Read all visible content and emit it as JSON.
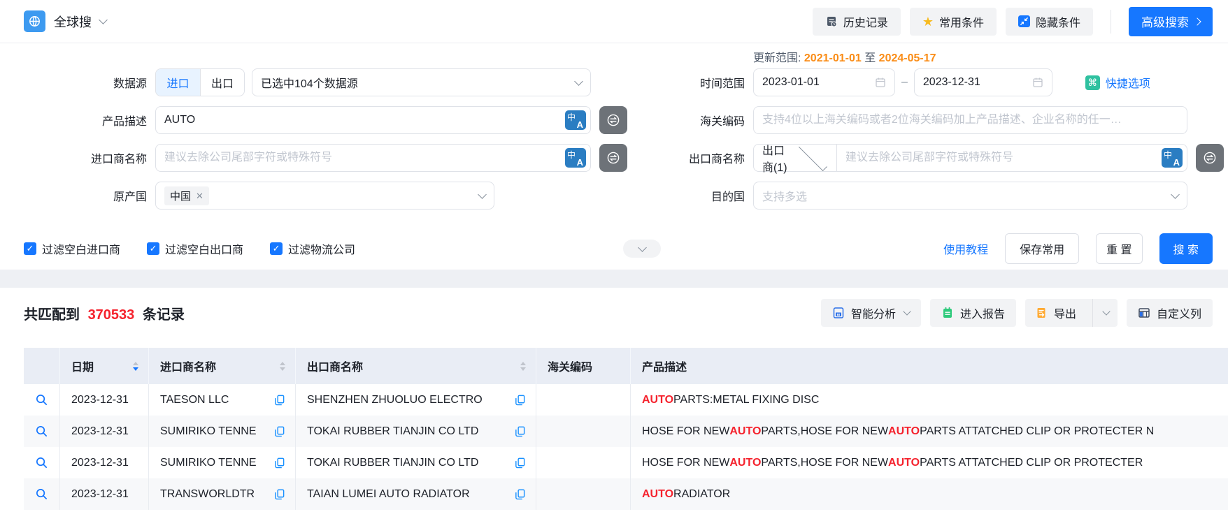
{
  "colors": {
    "primary": "#1677ff",
    "highlight_red": "#f5222d",
    "update_orange": "#fa8c16",
    "quick_green": "#2fc1a0",
    "report_green": "#2fca7c",
    "export_orange": "#ffaa33"
  },
  "topbar": {
    "app_title": "全球搜",
    "history_button": "历史记录",
    "favorites_button": "常用条件",
    "hide_conditions_button": "隐藏条件",
    "advanced_search_button": "高级搜索"
  },
  "form": {
    "update_range": {
      "label": "更新范围:",
      "start": "2021-01-01",
      "to": "至",
      "end": "2024-05-17"
    },
    "data_source": {
      "label": "数据源",
      "import_tab": "进口",
      "export_tab": "出口",
      "selected": "已选中104个数据源"
    },
    "time_range": {
      "label": "时间范围",
      "start": "2023-01-01",
      "dash": "–",
      "end": "2023-12-31",
      "quick_options": "快捷选项"
    },
    "product_desc": {
      "label": "产品描述",
      "value": "AUTO"
    },
    "hs_code": {
      "label": "海关编码",
      "placeholder": "支持4位以上海关编码或者2位海关编码加上产品描述、企业名称的任一…"
    },
    "importer": {
      "label": "进口商名称",
      "placeholder": "建议去除公司尾部字符或特殊符号"
    },
    "exporter": {
      "label": "出口商名称",
      "type_select": "出口商(1)",
      "placeholder": "建议去除公司尾部字符或特殊符号"
    },
    "origin_country": {
      "label": "原产国",
      "tag": "中国"
    },
    "dest_country": {
      "label": "目的国",
      "placeholder": "支持多选"
    },
    "filters": [
      {
        "label": "过滤空白进口商",
        "checked": true
      },
      {
        "label": "过滤空白出口商",
        "checked": true
      },
      {
        "label": "过滤物流公司",
        "checked": true
      }
    ],
    "actions": {
      "tutorial_link": "使用教程",
      "save_button": "保存常用",
      "reset_button": "重 置",
      "search_button": "搜 索"
    }
  },
  "results": {
    "summary": {
      "prefix": "共匹配到",
      "count": "370533",
      "suffix": "条记录"
    },
    "toolbar": {
      "analysis": "智能分析",
      "report": "进入报告",
      "export": "导出",
      "custom_columns": "自定义列"
    },
    "table": {
      "headers": [
        "日期",
        "进口商名称",
        "出口商名称",
        "海关编码",
        "产品描述"
      ],
      "sort": {
        "column": "日期",
        "direction": "desc"
      },
      "rows": [
        {
          "date": "2023-12-31",
          "importer": "TAESON LLC",
          "exporter": "SHENZHEN ZHUOLUO ELECTRO",
          "hs_code": "",
          "desc": [
            {
              "t": "AUTO",
              "h": true
            },
            {
              "t": " PARTS:METAL FIXING DISC",
              "h": false
            }
          ]
        },
        {
          "date": "2023-12-31",
          "importer": "SUMIRIKO TENNE",
          "exporter": "TOKAI RUBBER TIANJIN CO LTD",
          "hs_code": "",
          "desc": [
            {
              "t": "HOSE FOR NEW ",
              "h": false
            },
            {
              "t": "AUTO",
              "h": true
            },
            {
              "t": " PARTS,HOSE FOR NEW ",
              "h": false
            },
            {
              "t": "AUTO",
              "h": true
            },
            {
              "t": " PARTS ATTATCHED CLIP OR PROTECTER N",
              "h": false
            }
          ]
        },
        {
          "date": "2023-12-31",
          "importer": "SUMIRIKO TENNE",
          "exporter": "TOKAI RUBBER TIANJIN CO LTD",
          "hs_code": "",
          "desc": [
            {
              "t": "HOSE FOR NEW ",
              "h": false
            },
            {
              "t": "AUTO",
              "h": true
            },
            {
              "t": " PARTS,HOSE FOR NEW ",
              "h": false
            },
            {
              "t": "AUTO",
              "h": true
            },
            {
              "t": " PARTS ATTATCHED CLIP OR PROTECTER",
              "h": false
            }
          ]
        },
        {
          "date": "2023-12-31",
          "importer": "TRANSWORLDTR",
          "exporter": "TAIAN LUMEI AUTO RADIATOR",
          "hs_code": "",
          "desc": [
            {
              "t": "AUTO",
              "h": true
            },
            {
              "t": " RADIATOR",
              "h": false
            }
          ]
        }
      ]
    }
  }
}
